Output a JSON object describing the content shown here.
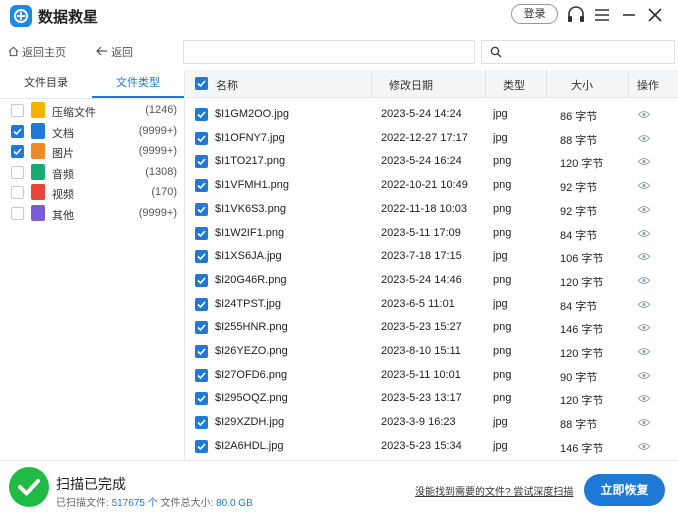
{
  "app": {
    "title": "数据救星",
    "login_label": "登录"
  },
  "nav": {
    "home_label": "返回主页",
    "back_label": "返回",
    "path_value": "",
    "search_value": ""
  },
  "left": {
    "tabs": [
      {
        "label": "文件目录"
      },
      {
        "label": "文件类型"
      }
    ],
    "active_tab": "文件类型",
    "categories": [
      {
        "label": "压缩文件",
        "count": "(1246)",
        "checked": false,
        "icon": "archive-icon",
        "color": "#f5b400"
      },
      {
        "label": "文档",
        "count": "(9999+)",
        "checked": true,
        "icon": "document-icon",
        "color": "#1e7ad6"
      },
      {
        "label": "图片",
        "count": "(9999+)",
        "checked": true,
        "icon": "image-icon",
        "color": "#f08a24"
      },
      {
        "label": "音频",
        "count": "(1308)",
        "checked": false,
        "icon": "audio-icon",
        "color": "#19a974"
      },
      {
        "label": "视频",
        "count": "(170)",
        "checked": false,
        "icon": "video-icon",
        "color": "#e8453c"
      },
      {
        "label": "其他",
        "count": "(9999+)",
        "checked": false,
        "icon": "other-icon",
        "color": "#7b5cd6"
      }
    ]
  },
  "table": {
    "headers": {
      "name": "名称",
      "date": "修改日期",
      "type": "类型",
      "size": "大小",
      "action": "操作"
    },
    "rows": [
      {
        "name": "$I1GM2OO.jpg",
        "date": "2023-5-24 14:24",
        "type": "jpg",
        "size": "86 字节"
      },
      {
        "name": "$I1OFNY7.jpg",
        "date": "2022-12-27 17:17",
        "type": "jpg",
        "size": "88 字节"
      },
      {
        "name": "$I1TO217.png",
        "date": "2023-5-24 16:24",
        "type": "png",
        "size": "120 字节"
      },
      {
        "name": "$I1VFMH1.png",
        "date": "2022-10-21 10:49",
        "type": "png",
        "size": "92 字节"
      },
      {
        "name": "$I1VK6S3.png",
        "date": "2022-11-18 10:03",
        "type": "png",
        "size": "92 字节"
      },
      {
        "name": "$I1W2IF1.png",
        "date": "2023-5-11 17:09",
        "type": "png",
        "size": "84 字节"
      },
      {
        "name": "$I1XS6JA.jpg",
        "date": "2023-7-18 17:15",
        "type": "jpg",
        "size": "106 字节"
      },
      {
        "name": "$I20G46R.png",
        "date": "2023-5-24 14:46",
        "type": "png",
        "size": "120 字节"
      },
      {
        "name": "$I24TPST.jpg",
        "date": "2023-6-5 11:01",
        "type": "jpg",
        "size": "84 字节"
      },
      {
        "name": "$I255HNR.png",
        "date": "2023-5-23 15:27",
        "type": "png",
        "size": "146 字节"
      },
      {
        "name": "$I26YEZO.png",
        "date": "2023-8-10 15:11",
        "type": "png",
        "size": "120 字节"
      },
      {
        "name": "$I27OFD6.png",
        "date": "2023-5-11 10:01",
        "type": "png",
        "size": "90 字节"
      },
      {
        "name": "$I295OQZ.png",
        "date": "2023-5-23 13:17",
        "type": "png",
        "size": "120 字节"
      },
      {
        "name": "$I29XZDH.jpg",
        "date": "2023-3-9 16:23",
        "type": "jpg",
        "size": "88 字节"
      },
      {
        "name": "$I2A6HDL.jpg",
        "date": "2023-5-23 15:34",
        "type": "jpg",
        "size": "146 字节"
      }
    ]
  },
  "status": {
    "title": "扫描已完成",
    "scanned_label": "已扫描文件:",
    "scanned_count": "517675 个",
    "total_label": "文件总大小:",
    "total_size": "80.0 GB",
    "deep_scan_link": "没能找到需要的文件? 尝试深度扫描",
    "recover_button": "立即恢复"
  },
  "colors": {
    "accent": "#1e7ad6",
    "success": "#21ba45"
  }
}
